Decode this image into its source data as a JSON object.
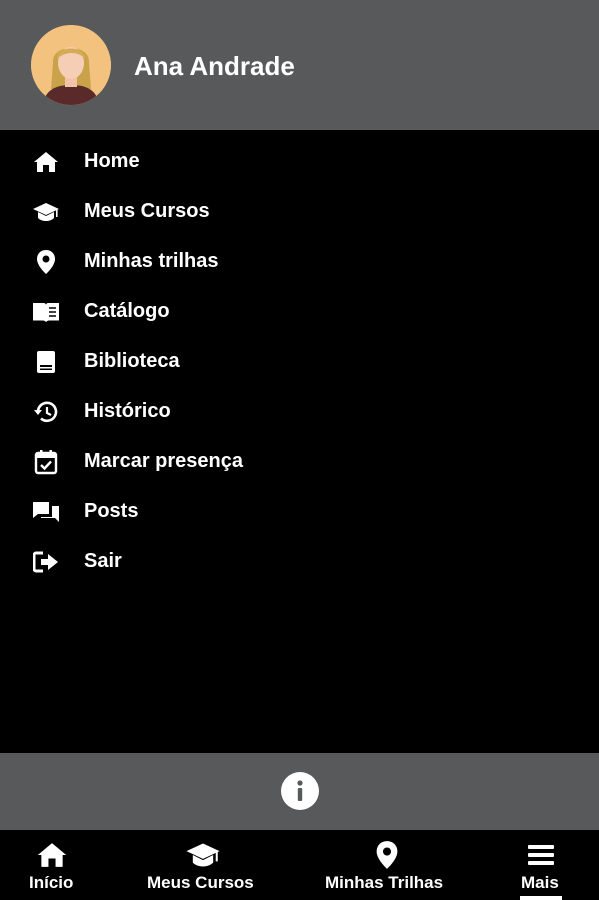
{
  "profile": {
    "name": "Ana Andrade",
    "avatar_icon": "user-avatar-icon"
  },
  "menu": {
    "items": [
      {
        "label": "Home",
        "icon": "home-icon"
      },
      {
        "label": "Meus Cursos",
        "icon": "graduation-cap-icon"
      },
      {
        "label": "Minhas trilhas",
        "icon": "map-pin-icon"
      },
      {
        "label": "Catálogo",
        "icon": "open-book-icon"
      },
      {
        "label": "Biblioteca",
        "icon": "book-icon"
      },
      {
        "label": "Histórico",
        "icon": "history-icon"
      },
      {
        "label": "Marcar presença",
        "icon": "calendar-check-icon"
      },
      {
        "label": "Posts",
        "icon": "chat-icon"
      },
      {
        "label": "Sair",
        "icon": "logout-icon"
      }
    ]
  },
  "info": {
    "icon": "info-icon"
  },
  "bottom_nav": {
    "items": [
      {
        "label": "Início",
        "icon": "home-icon"
      },
      {
        "label": "Meus Cursos",
        "icon": "graduation-cap-icon"
      },
      {
        "label": "Minhas Trilhas",
        "icon": "map-pin-icon"
      },
      {
        "label": "Mais",
        "icon": "menu-icon",
        "active": true
      }
    ]
  },
  "colors": {
    "header_bg": "#58595b",
    "menu_bg": "#000000",
    "text": "#ffffff"
  }
}
